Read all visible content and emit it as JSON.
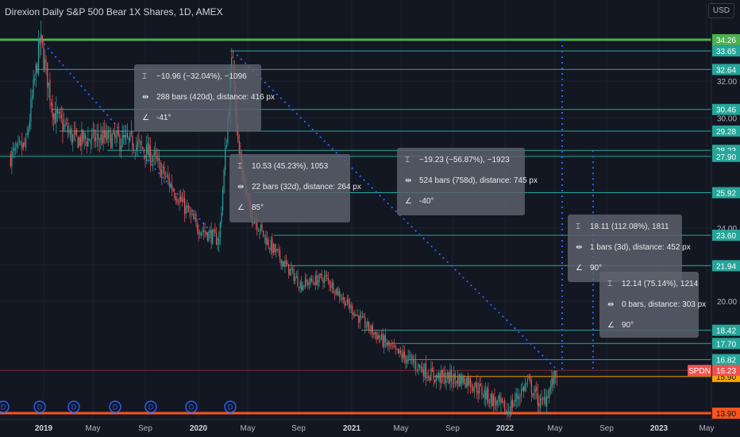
{
  "header": {
    "title": "Direxion Daily S&P 500 Bear 1X Shares, 1D, AMEX",
    "currency": "USD"
  },
  "colors": {
    "background": "#131722",
    "up_candle": "#26a69a",
    "down_candle": "#ef5350",
    "level_line": "#26a69a",
    "trendline": "#2962ff",
    "top_line": "#4caf50",
    "price_line": "#f7a600",
    "low_line": "#f7531c"
  },
  "chart_data": {
    "type": "candlestick",
    "symbol": "SPDN",
    "x_ticks": [
      "2019",
      "May",
      "Sep",
      "2020",
      "May",
      "Sep",
      "2021",
      "May",
      "Sep",
      "2022",
      "May",
      "Sep",
      "2023",
      "May"
    ],
    "y_ticks": [
      32.0,
      30.0,
      28.0,
      26.0,
      24.0,
      22.0,
      20.0
    ],
    "ylim": [
      13.6,
      35.4
    ],
    "price_path": [
      {
        "t": "2018-10-15",
        "v": 27.9
      },
      {
        "t": "2018-11-20",
        "v": 28.5
      },
      {
        "t": "2018-12-24",
        "v": 34.26
      },
      {
        "t": "2019-01-25",
        "v": 30.2
      },
      {
        "t": "2019-03-15",
        "v": 28.8
      },
      {
        "t": "2019-06-03",
        "v": 28.9
      },
      {
        "t": "2019-08-05",
        "v": 28.6
      },
      {
        "t": "2019-09-15",
        "v": 27.9
      },
      {
        "t": "2019-12-27",
        "v": 24.1
      },
      {
        "t": "2020-02-19",
        "v": 23.3
      },
      {
        "t": "2020-03-23",
        "v": 33.65
      },
      {
        "t": "2020-04-05",
        "v": 28.3
      },
      {
        "t": "2020-05-01",
        "v": 25.0
      },
      {
        "t": "2020-06-15",
        "v": 23.2
      },
      {
        "t": "2020-09-01",
        "v": 20.9
      },
      {
        "t": "2020-10-30",
        "v": 21.3
      },
      {
        "t": "2021-01-25",
        "v": 18.9
      },
      {
        "t": "2021-04-15",
        "v": 17.2
      },
      {
        "t": "2021-05-12",
        "v": 16.9
      },
      {
        "t": "2021-07-15",
        "v": 15.9
      },
      {
        "t": "2021-10-04",
        "v": 15.7
      },
      {
        "t": "2021-12-31",
        "v": 14.1
      },
      {
        "t": "2022-01-03",
        "v": 13.9
      },
      {
        "t": "2022-02-24",
        "v": 15.6
      },
      {
        "t": "2022-03-29",
        "v": 14.3
      },
      {
        "t": "2022-05-06",
        "v": 16.23
      }
    ],
    "horizontal_levels": [
      {
        "value": 34.26,
        "label": "34.26",
        "color": "#4caf50"
      },
      {
        "value": 33.65,
        "label": "33.65",
        "color": "#26a69a"
      },
      {
        "value": 32.64,
        "label": "32.64",
        "color": "#26a69a"
      },
      {
        "value": 30.46,
        "label": "30.46",
        "color": "#26a69a"
      },
      {
        "value": 29.28,
        "label": "29.28",
        "color": "#26a69a"
      },
      {
        "value": 28.23,
        "label": "28.23",
        "color": "#26a69a"
      },
      {
        "value": 27.9,
        "label": "27.90",
        "color": "#26a69a"
      },
      {
        "value": 25.92,
        "label": "25.92",
        "color": "#26a69a"
      },
      {
        "value": 23.6,
        "label": "23.60",
        "color": "#26a69a"
      },
      {
        "value": 21.94,
        "label": "21.94",
        "color": "#26a69a"
      },
      {
        "value": 18.42,
        "label": "18.42",
        "color": "#26a69a"
      },
      {
        "value": 17.7,
        "label": "17.70",
        "color": "#26a69a"
      },
      {
        "value": 16.82,
        "label": "16.82",
        "color": "#26a69a"
      },
      {
        "value": 15.9,
        "label": "15.90",
        "color": "#f7a600"
      },
      {
        "value": 13.9,
        "label": "13.90",
        "color": "#f7531c"
      }
    ],
    "current_price": {
      "ticker": "SPDN",
      "value": 16.23,
      "label": "16.23"
    },
    "dividend_markers": [
      "D",
      "D",
      "D",
      "D",
      "D",
      "D",
      "D"
    ],
    "measurements": [
      {
        "price": "−10.96 (−32.04%), −1096",
        "range": "288 bars (420d), distance: 416 px",
        "angle": "-41°"
      },
      {
        "price": "10.53 (45.23%), 1053",
        "range": "22 bars (32d), distance: 264 px",
        "angle": "85°"
      },
      {
        "price": "−19.23 (−56.87%), −1923",
        "range": "524 bars (758d), distance: 745 px",
        "angle": "-40°"
      },
      {
        "price": "18.11 (112.08%), 1811",
        "range": "1 bars (3d), distance: 452 px",
        "angle": "90°"
      },
      {
        "price": "12.14 (75.14%), 1214",
        "range": "0 bars, distance: 303 px",
        "angle": "90°"
      }
    ]
  }
}
